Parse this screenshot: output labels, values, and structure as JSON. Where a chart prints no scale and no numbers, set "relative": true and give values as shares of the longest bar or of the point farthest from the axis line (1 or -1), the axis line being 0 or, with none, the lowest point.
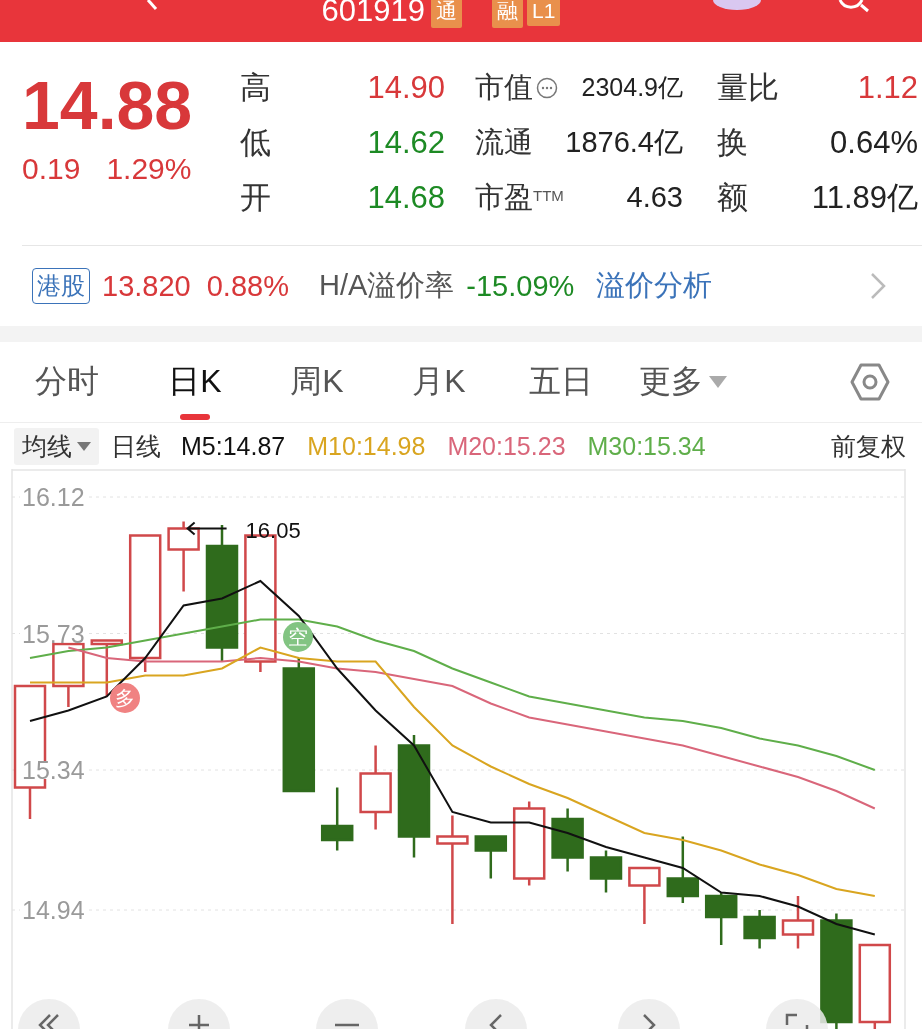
{
  "header": {
    "code": "601919",
    "badges": [
      "通",
      "融",
      "L1"
    ]
  },
  "quote": {
    "price": "14.88",
    "change": "0.19",
    "change_pct": "1.29%",
    "color": "#d8383a"
  },
  "stats": [
    {
      "label": "高",
      "value": "14.90",
      "color": "#d8383a"
    },
    {
      "label": "市值",
      "value": "2304.9亿",
      "color": "#222222",
      "has_icon": true
    },
    {
      "label": "量比",
      "value": "1.12",
      "color": "#d8383a"
    },
    {
      "label": "低",
      "value": "14.62",
      "color": "#1d8a24"
    },
    {
      "label": "流通",
      "value": "1876.4亿",
      "color": "#222222",
      "has_icon": false
    },
    {
      "label": "换",
      "value": "0.64%",
      "color": "#222222"
    },
    {
      "label": "开",
      "value": "14.68",
      "color": "#1d8a24"
    },
    {
      "label": "市盈$^{TTM}$",
      "value": "4.63",
      "color": "#222222",
      "has_icon": false
    },
    {
      "label": "额",
      "value": "11.89亿",
      "color": "#222222"
    }
  ],
  "hk": {
    "tag": "港股",
    "price": "13.820",
    "change_pct": "0.88%",
    "color": "#d8383a",
    "premium_label": "H/A溢价率",
    "premium": {
      "text": "-15.09%",
      "color": "#1d8a24"
    },
    "link": "溢价分析"
  },
  "tabs": [
    {
      "label": "分时",
      "selected": false,
      "kind": "tab"
    },
    {
      "label": "日K",
      "selected": true,
      "kind": "tab"
    },
    {
      "label": "周K",
      "selected": false,
      "kind": "tab"
    },
    {
      "label": "月K",
      "selected": false,
      "kind": "tab"
    },
    {
      "label": "五日",
      "selected": false,
      "kind": "tab"
    },
    {
      "label": "更多",
      "selected": false,
      "kind": "dropdown"
    }
  ],
  "legend": {
    "selector": "均线",
    "period": "日线",
    "adjust": "前复权"
  },
  "chart": {
    "chart_data": {
      "type": "candlestick",
      "ylim": [
        14.58,
        16.2
      ],
      "grid": true,
      "yticks": [
        {
          "value": 16.12,
          "label": "16.12"
        },
        {
          "value": 15.73,
          "label": "15.73"
        },
        {
          "value": 15.34,
          "label": "15.34"
        },
        {
          "value": 14.94,
          "label": "14.94"
        }
      ],
      "ohlc": [
        [
          15.29,
          15.58,
          15.2,
          15.58
        ],
        [
          15.58,
          15.7,
          15.52,
          15.7
        ],
        [
          15.7,
          15.71,
          15.55,
          15.71
        ],
        [
          15.66,
          16.01,
          15.62,
          16.01
        ],
        [
          15.97,
          16.05,
          15.85,
          16.03
        ],
        [
          15.98,
          16.04,
          15.65,
          15.69
        ],
        [
          15.65,
          16.01,
          15.62,
          16.01
        ],
        [
          15.63,
          15.66,
          15.28,
          15.28
        ],
        [
          15.18,
          15.29,
          15.11,
          15.14
        ],
        [
          15.22,
          15.41,
          15.17,
          15.33
        ],
        [
          15.41,
          15.44,
          15.09,
          15.15
        ],
        [
          15.13,
          15.21,
          14.9,
          15.15
        ],
        [
          15.15,
          15.15,
          15.03,
          15.11
        ],
        [
          15.03,
          15.25,
          15.01,
          15.23
        ],
        [
          15.2,
          15.23,
          15.05,
          15.09
        ],
        [
          15.09,
          15.11,
          14.99,
          15.03
        ],
        [
          15.01,
          15.06,
          14.9,
          15.06
        ],
        [
          15.03,
          15.15,
          14.96,
          14.98
        ],
        [
          14.98,
          14.99,
          14.84,
          14.92
        ],
        [
          14.92,
          14.94,
          14.83,
          14.86
        ],
        [
          14.87,
          14.98,
          14.83,
          14.91
        ],
        [
          14.91,
          14.93,
          14.6,
          14.62
        ],
        [
          14.62,
          14.84,
          14.6,
          14.84
        ]
      ],
      "annotations": [
        "16.05"
      ]
    },
    "markers": [
      {
        "text": "多",
        "kind": "long"
      },
      {
        "text": "空",
        "kind": "short"
      }
    ]
  },
  "moving_averages": {
    "chart_data": {
      "type": "line",
      "ylim": [
        14.58,
        16.2
      ],
      "relative": true,
      "series": [
        {
          "name": "M5:14.87",
          "color": "#111111",
          "values": [
            15.48,
            15.51,
            15.55,
            15.66,
            15.81,
            15.83,
            15.88,
            15.78,
            15.63,
            15.51,
            15.41,
            15.22,
            15.19,
            15.19,
            15.16,
            15.12,
            15.09,
            15.06,
            14.99,
            14.98,
            14.95,
            14.9,
            14.87
          ]
        },
        {
          "name": "M10:14.98",
          "color": "#d9a520",
          "values": [
            15.59,
            15.59,
            15.59,
            15.61,
            15.61,
            15.63,
            15.69,
            15.66,
            15.65,
            15.65,
            15.52,
            15.41,
            15.35,
            15.3,
            15.26,
            15.21,
            15.16,
            15.14,
            15.11,
            15.07,
            15.04,
            15.0,
            14.98
          ]
        },
        {
          "name": "M20:15.23",
          "color": "#d9667a",
          "values": [
            null,
            15.69,
            15.66,
            15.65,
            15.65,
            15.65,
            15.66,
            15.65,
            15.63,
            15.62,
            15.6,
            15.58,
            15.53,
            15.49,
            15.47,
            15.45,
            15.43,
            15.41,
            15.38,
            15.35,
            15.32,
            15.28,
            15.23
          ]
        },
        {
          "name": "M30:15.34",
          "color": "#5fae4a",
          "values": [
            15.66,
            15.68,
            15.69,
            15.71,
            15.73,
            15.75,
            15.77,
            15.77,
            15.75,
            15.71,
            15.68,
            15.63,
            15.59,
            15.55,
            15.53,
            15.51,
            15.49,
            15.48,
            15.46,
            15.43,
            15.41,
            15.38,
            15.34
          ]
        }
      ]
    }
  }
}
